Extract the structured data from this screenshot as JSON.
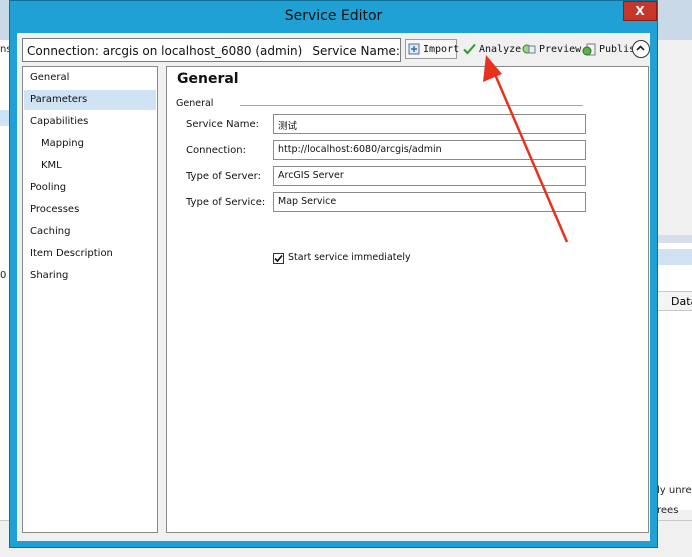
{
  "window": {
    "title": "Service Editor",
    "close_label": "X"
  },
  "toolbar": {
    "connection_text": "Connection: arcgis on localhost_6080 (admin)",
    "service_name_text": "Service Name: 测试",
    "import_label": "Import",
    "analyze_label": "Analyze",
    "preview_label": "Preview",
    "publish_label": "Publish"
  },
  "nav": {
    "items": [
      {
        "label": "General",
        "selected": false
      },
      {
        "label": "Parameters",
        "selected": true
      },
      {
        "label": "Capabilities",
        "selected": false
      },
      {
        "label": "Mapping",
        "selected": false
      },
      {
        "label": "KML",
        "selected": false
      },
      {
        "label": "Pooling",
        "selected": false
      },
      {
        "label": "Processes",
        "selected": false
      },
      {
        "label": "Caching",
        "selected": false
      },
      {
        "label": "Item Description",
        "selected": false
      },
      {
        "label": "Sharing",
        "selected": false
      }
    ]
  },
  "content": {
    "title": "General",
    "group_label": "General",
    "fields": [
      {
        "label": "Service Name:",
        "value": "测试"
      },
      {
        "label": "Connection:",
        "value": "http://localhost:6080/arcgis/admin"
      },
      {
        "label": "Type of Server:",
        "value": "ArcGIS Server"
      },
      {
        "label": "Type of Service:",
        "value": "Map Service"
      }
    ],
    "start_checkbox_label": "Start service immediately",
    "start_checked": true
  },
  "background": {
    "frag_ns": "ns",
    "frag_zero": "0",
    "col_header": "Data",
    "row1": "ly unre",
    "row2": "rees"
  },
  "colors": {
    "title_bar": "#1fa1d6",
    "close_button": "#c7362b",
    "selection": "#cfe3f5",
    "annotation_arrow": "#e8321e",
    "analyze_check": "#2e9a2e"
  }
}
